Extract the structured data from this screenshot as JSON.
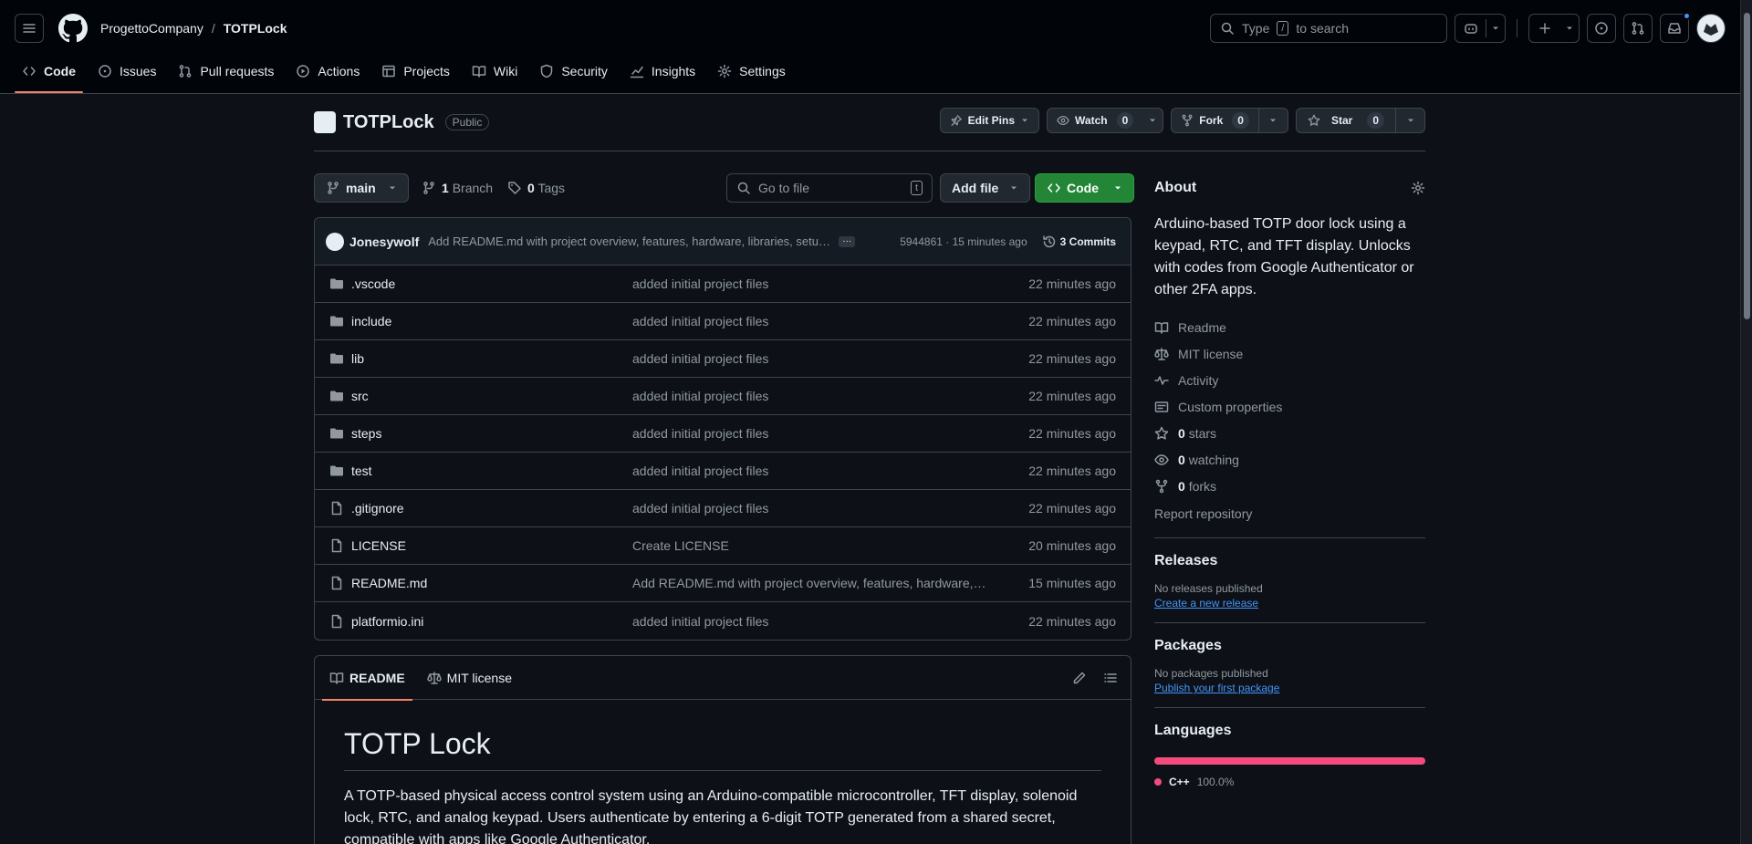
{
  "header": {
    "owner": "ProgettoCompany",
    "separator": "/",
    "repo": "TOTPLock",
    "search_placeholder_pre": "Type",
    "search_key": "/",
    "search_placeholder_post": "to search"
  },
  "nav_tabs": [
    {
      "label": "Code",
      "icon": "code-icon",
      "active": true
    },
    {
      "label": "Issues",
      "icon": "issue-icon"
    },
    {
      "label": "Pull requests",
      "icon": "pull-request-icon"
    },
    {
      "label": "Actions",
      "icon": "play-icon"
    },
    {
      "label": "Projects",
      "icon": "table-icon"
    },
    {
      "label": "Wiki",
      "icon": "book-icon"
    },
    {
      "label": "Security",
      "icon": "shield-icon"
    },
    {
      "label": "Insights",
      "icon": "graph-icon"
    },
    {
      "label": "Settings",
      "icon": "gear-icon"
    }
  ],
  "repo": {
    "name": "TOTPLock",
    "visibility": "Public",
    "edit_pins": "Edit Pins",
    "watch": "Watch",
    "watch_count": "0",
    "fork": "Fork",
    "fork_count": "0",
    "star": "Star",
    "star_count": "0"
  },
  "filenav": {
    "branch": "main",
    "branch_count": "1",
    "branch_label": "Branch",
    "tag_count": "0",
    "tag_label": "Tags",
    "gofile_placeholder": "Go to file",
    "gofile_key": "t",
    "add_file": "Add file",
    "code": "Code"
  },
  "commit": {
    "author": "Jonesywolf",
    "message": "Add README.md with project overview, features, hardware, libraries, setup instructions",
    "meta": "5944861 · 15 minutes ago",
    "commits_label": "3 Commits"
  },
  "files": [
    {
      "name": ".vscode",
      "type": "dir",
      "message": "added initial project files",
      "date": "22 minutes ago"
    },
    {
      "name": "include",
      "type": "dir",
      "message": "added initial project files",
      "date": "22 minutes ago"
    },
    {
      "name": "lib",
      "type": "dir",
      "message": "added initial project files",
      "date": "22 minutes ago"
    },
    {
      "name": "src",
      "type": "dir",
      "message": "added initial project files",
      "date": "22 minutes ago"
    },
    {
      "name": "steps",
      "type": "dir",
      "message": "added initial project files",
      "date": "22 minutes ago"
    },
    {
      "name": "test",
      "type": "dir",
      "message": "added initial project files",
      "date": "22 minutes ago"
    },
    {
      "name": ".gitignore",
      "type": "file",
      "message": "added initial project files",
      "date": "22 minutes ago"
    },
    {
      "name": "LICENSE",
      "type": "file",
      "message": "Create LICENSE",
      "date": "20 minutes ago"
    },
    {
      "name": "README.md",
      "type": "file",
      "message": "Add README.md with project overview, features, hardware, libraries, setup instructions",
      "date": "15 minutes ago"
    },
    {
      "name": "platformio.ini",
      "type": "file",
      "message": "added initial project files",
      "date": "22 minutes ago"
    }
  ],
  "readme": {
    "tab_readme": "README",
    "tab_license": "MIT license",
    "title": "TOTP Lock",
    "body": "A TOTP-based physical access control system using an Arduino-compatible microcontroller, TFT display, solenoid lock, RTC, and analog keypad. Users authenticate by entering a 6-digit TOTP generated from a shared secret, compatible with apps like Google Authenticator."
  },
  "about": {
    "title": "About",
    "description": "Arduino-based TOTP door lock using a keypad, RTC, and TFT display. Unlocks with codes from Google Authenticator or other 2FA apps.",
    "items": [
      {
        "label": "Readme",
        "icon": "book-icon"
      },
      {
        "label": "MIT license",
        "icon": "law-icon"
      },
      {
        "label": "Activity",
        "icon": "pulse-icon"
      },
      {
        "label": "Custom properties",
        "icon": "note-icon"
      },
      {
        "count": "0",
        "label": "stars",
        "icon": "star-icon"
      },
      {
        "count": "0",
        "label": "watching",
        "icon": "eye-icon"
      },
      {
        "count": "0",
        "label": "forks",
        "icon": "fork-icon"
      }
    ],
    "report": "Report repository"
  },
  "releases": {
    "title": "Releases",
    "empty": "No releases published",
    "link": "Create a new release"
  },
  "packages": {
    "title": "Packages",
    "empty": "No packages published",
    "link": "Publish your first package"
  },
  "languages": {
    "title": "Languages",
    "items": [
      {
        "name": "C++",
        "percent": "100.0%",
        "color": "#f34b7d",
        "fraction": 1.0
      }
    ]
  }
}
